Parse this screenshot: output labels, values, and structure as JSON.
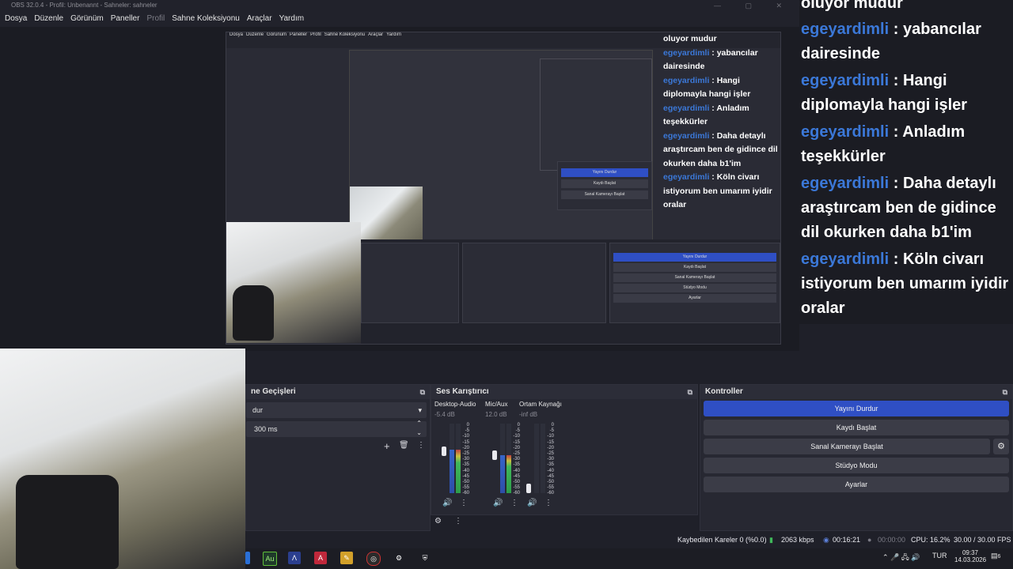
{
  "window": {
    "title": "OBS 32.0.4 - Profil: Unbenannt - Sahneler: sahneler"
  },
  "menu": [
    "Dosya",
    "Düzenle",
    "Görünüm",
    "Paneller",
    "Profil",
    "Sahne Koleksiyonu",
    "Araçlar",
    "Yardım"
  ],
  "chat": [
    {
      "user": "",
      "text": "oluyor mudur"
    },
    {
      "user": "egeyardimli",
      "text": ": yabancılar dairesinde"
    },
    {
      "user": "egeyardimli",
      "text": ": Hangi diplomayla hangi işler"
    },
    {
      "user": "egeyardimli",
      "text": ": Anladım teşekkürler"
    },
    {
      "user": "egeyardimli",
      "text": ": Daha detaylı araştırcam ben de gidince dil okurken daha b1'im"
    },
    {
      "user": "egeyardimli",
      "text": ": Köln civarı istiyorum ben umarım iyidir oralar"
    }
  ],
  "transitions": {
    "title": "ne Geçişleri",
    "selected": "dur",
    "duration": "300 ms"
  },
  "mixer": {
    "title": "Ses Karıştırıcı",
    "channels": [
      {
        "name": "Desktop-Audio",
        "db": "-5.4 dB",
        "level": 0.62,
        "muted": false
      },
      {
        "name": "Mic/Aux",
        "db": "12.0 dB",
        "level": 0.55,
        "muted": false
      },
      {
        "name": "Ortam Kaynağı",
        "db": "-inf dB",
        "level": 0.0,
        "muted": false
      }
    ],
    "scale": [
      "0",
      "-5",
      "-10",
      "-15",
      "-20",
      "-25",
      "-30",
      "-35",
      "-40",
      "-45",
      "-50",
      "-55",
      "-60"
    ]
  },
  "controls": {
    "title": "Kontroller",
    "buttons": [
      "Yayını Durdur",
      "Kaydı Başlat",
      "Sanal Kamerayı Başlat",
      "Stüdyo Modu",
      "Ayarlar"
    ]
  },
  "status": {
    "dropped": "Kaybedilen Kareler 0 (%0.0)",
    "bitrate": "2063 kbps",
    "live_time": "00:16:21",
    "rec_time": "00:00:00",
    "cpu": "CPU: 16.2%",
    "fps": "30.00 / 30.00 FPS"
  },
  "taskbar": {
    "lang": "TUR",
    "time": "09:37",
    "date": "14.03.2026",
    "notif": "6"
  },
  "colors": {
    "accent": "#2f4fc4",
    "chat_user": "#3b78d8",
    "panel": "#272832"
  }
}
